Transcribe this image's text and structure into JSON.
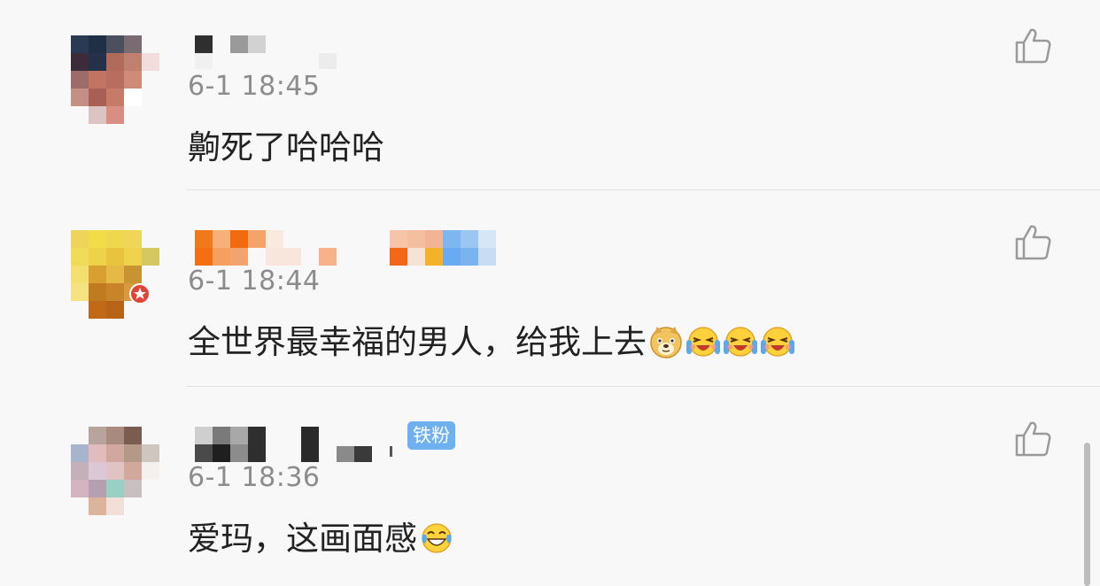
{
  "comments": [
    {
      "time": "6-1 18:45",
      "text": "齁死了哈哈哈",
      "emojis": []
    },
    {
      "time": "6-1 18:44",
      "text": "全世界最幸福的男人，给我上去",
      "emojis": [
        "doge-emoji",
        "laughing-crying-emoji",
        "laughing-crying-emoji",
        "laughing-crying-emoji"
      ]
    },
    {
      "time": "6-1 18:36",
      "text": "爱玛，这画面感",
      "badge": "铁粉",
      "emojis": [
        "tears-of-joy-emoji"
      ]
    }
  ],
  "colors": {
    "background": "#f8f8f8",
    "text": "#222222",
    "timestamp": "#8c8c8c",
    "badge": "#6fb1f0",
    "divider": "#e2e2e2"
  },
  "icons": {
    "like": "thumbs-up-outline-icon"
  }
}
